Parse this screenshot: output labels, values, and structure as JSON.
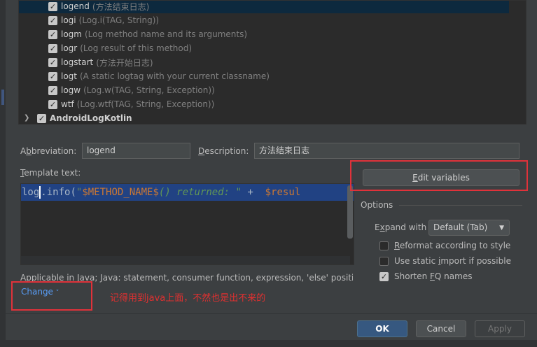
{
  "tree": {
    "items": [
      {
        "name": "logend",
        "desc": "(方法结束日志)",
        "checked": true,
        "selected": true
      },
      {
        "name": "logi",
        "desc": "(Log.i(TAG, String))",
        "checked": true
      },
      {
        "name": "logm",
        "desc": "(Log method name and its arguments)",
        "checked": true
      },
      {
        "name": "logr",
        "desc": "(Log result of this method)",
        "checked": true
      },
      {
        "name": "logstart",
        "desc": "(方法开始日志)",
        "checked": true
      },
      {
        "name": "logt",
        "desc": "(A static logtag with your current classname)",
        "checked": true
      },
      {
        "name": "logw",
        "desc": "(Log.w(TAG, String, Exception))",
        "checked": true
      },
      {
        "name": "wtf",
        "desc": "(Log.wtf(TAG, String, Exception))",
        "checked": true
      }
    ],
    "group": {
      "name": "AndroidLogKotlin",
      "checked": true
    }
  },
  "form": {
    "abbreviation_label_pre": "A",
    "abbreviation_label_u": "b",
    "abbreviation_label_post": "breviation:",
    "abbreviation_value": "logend",
    "description_label_u": "D",
    "description_label_post": "escription:",
    "description_value": "方法结束日志",
    "template_label_u": "T",
    "template_label_post": "emplate text:"
  },
  "editor": {
    "tok1": "log",
    "tok2": ".info(",
    "tok3": "\"",
    "tok4": "$METHOD_NAME$",
    "tok5": "() returned: \"",
    "tok6": " +  ",
    "tok7": "$resul"
  },
  "buttons": {
    "edit_variables_u": "E",
    "edit_variables_post": "dit variables",
    "ok": "OK",
    "cancel": "Cancel",
    "apply": "Apply"
  },
  "options": {
    "title": "Options",
    "expand_label_pre": "E",
    "expand_label_u": "x",
    "expand_label_post": "pand with",
    "expand_value": "Default (Tab)",
    "reformat_u": "R",
    "reformat_post": "eformat according to style",
    "reformat_checked": false,
    "static_import_pre": "Use static ",
    "static_import_u": "i",
    "static_import_post": "mport if possible",
    "static_import_checked": false,
    "shorten_pre": "Shorten ",
    "shorten_u": "F",
    "shorten_post": "Q names",
    "shorten_checked": true
  },
  "applicable": {
    "text": "Applicable in Java; Java: statement, consumer function, expression, 'else' positio...",
    "change": "Change"
  },
  "annotation": {
    "text": "记得用到java上面，不然也是出不来的",
    "color": "#e03030"
  },
  "icons": {
    "check": "check-icon",
    "expand_arrow": "chevron-right-icon",
    "dropdown": "chevron-down-icon"
  }
}
